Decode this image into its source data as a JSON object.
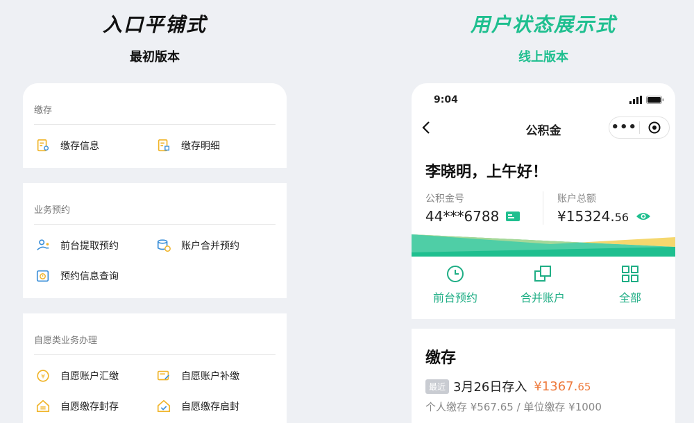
{
  "left_heading": {
    "title": "入口平铺式",
    "subtitle": "最初版本"
  },
  "right_heading": {
    "title": "用户状态展示式",
    "subtitle": "线上版本"
  },
  "left_card": {
    "sections": [
      {
        "title": "缴存",
        "items": [
          "缴存信息",
          "缴存明细"
        ]
      },
      {
        "title": "业务预约",
        "items": [
          "前台提取预约",
          "账户合并预约",
          "预约信息查询"
        ]
      },
      {
        "title": "自愿类业务办理",
        "items": [
          "自愿账户汇缴",
          "自愿账户补缴",
          "自愿缴存封存",
          "自愿缴存启封"
        ]
      }
    ]
  },
  "phone": {
    "time": "9:04",
    "nav_title": "公积金",
    "capsule_dots": "•••",
    "greeting": "李晓明，上午好！",
    "fund_number_label": "公积金号",
    "fund_number": "44***6788",
    "balance_label": "账户总额",
    "balance_main": "¥15324.",
    "balance_cents": "56",
    "shortcuts": [
      "前台预约",
      "合并账户",
      "全部"
    ],
    "deposit_title": "缴存",
    "recent_badge": "最近",
    "recent_text": "3月26日存入",
    "recent_amount_main": "¥1367.",
    "recent_amount_cents": "65",
    "split_text": "个人缴存 ¥567.65 / 单位缴存 ¥1000"
  },
  "colors": {
    "accent_green": "#1fbf8f",
    "icon_yellow": "#f0b429",
    "icon_blue": "#3b8fd8",
    "amount_orange": "#ee7a3c"
  }
}
